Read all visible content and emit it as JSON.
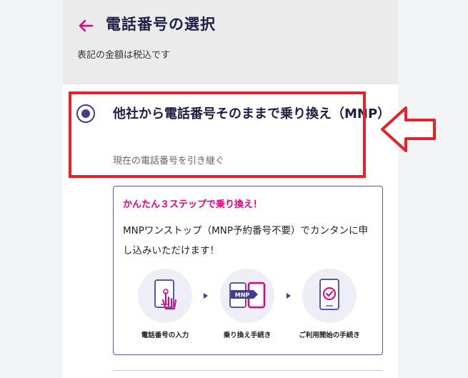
{
  "header": {
    "title": "電話番号の選択",
    "tax_note": "表記の金額は税込です"
  },
  "option": {
    "title": "他社から電話番号そのままで乗り換え（MNP）",
    "subtitle": "現在の電話番号を引き継ぐ",
    "selected": true
  },
  "card": {
    "heading": "かんたん３ステップで乗り換え！",
    "body": "MNPワンストップ（MNP予約番号不要）でカンタンに申し込みいただけます！",
    "steps": [
      {
        "label": "電話番号の入力",
        "icon": "phone-touch-icon"
      },
      {
        "label": "乗り換え手続き",
        "icon": "mnp-transfer-icon"
      },
      {
        "label": "ご利用開始の手続き",
        "icon": "phone-check-icon"
      }
    ],
    "badge": "MNP"
  },
  "colors": {
    "accent": "#e6007e",
    "primary": "#3f3f8f",
    "highlight": "#e8202a",
    "header_bg": "#ebebeb"
  }
}
